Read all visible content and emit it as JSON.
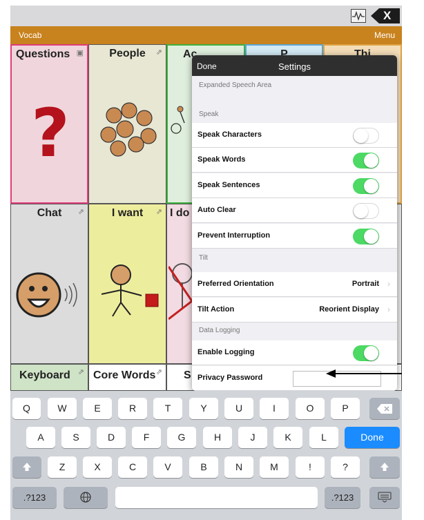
{
  "nav": {
    "vocab": "Vocab",
    "menu": "Menu"
  },
  "grid": {
    "row1": [
      "Questions",
      "People",
      "Ac",
      "P",
      "Thi"
    ],
    "row2": [
      "Chat",
      "I want",
      "I do"
    ],
    "row3": [
      "Keyboard",
      "Core Words",
      "S"
    ]
  },
  "settings": {
    "done": "Done",
    "title": "Settings",
    "sections": {
      "expanded": "Expanded Speech Area",
      "speak": "Speak",
      "tilt": "Tilt",
      "logging": "Data Logging"
    },
    "rows": {
      "speak_characters": {
        "label": "Speak Characters",
        "on": false
      },
      "speak_words": {
        "label": "Speak Words",
        "on": true
      },
      "speak_sentences": {
        "label": "Speak Sentences",
        "on": true
      },
      "auto_clear": {
        "label": "Auto Clear",
        "on": false
      },
      "prevent_interruption": {
        "label": "Prevent Interruption",
        "on": true
      },
      "preferred_orientation": {
        "label": "Preferred Orientation",
        "value": "Portrait"
      },
      "tilt_action": {
        "label": "Tilt Action",
        "value": "Reorient Display"
      },
      "enable_logging": {
        "label": "Enable Logging",
        "on": true
      },
      "privacy_password": {
        "label": "Privacy Password",
        "value": ""
      }
    }
  },
  "keyboard": {
    "row1": [
      "Q",
      "W",
      "E",
      "R",
      "T",
      "Y",
      "U",
      "I",
      "O",
      "P"
    ],
    "row2": [
      "A",
      "S",
      "D",
      "F",
      "G",
      "H",
      "J",
      "K",
      "L"
    ],
    "row3": [
      "Z",
      "X",
      "C",
      "V",
      "B",
      "N",
      "M",
      "!",
      "?"
    ],
    "done": "Done",
    "num_left": ".?123",
    "num_right": ".?123"
  },
  "colors": {
    "nav": "#c8821e",
    "toggle_on": "#4cd964",
    "done_key": "#1a8cff"
  },
  "icons": {
    "clear": "backspace-x-icon",
    "speech": "waveform-icon",
    "pin": "pin-icon",
    "globe": "globe-icon",
    "hide_keyboard": "keyboard-hide-icon"
  }
}
